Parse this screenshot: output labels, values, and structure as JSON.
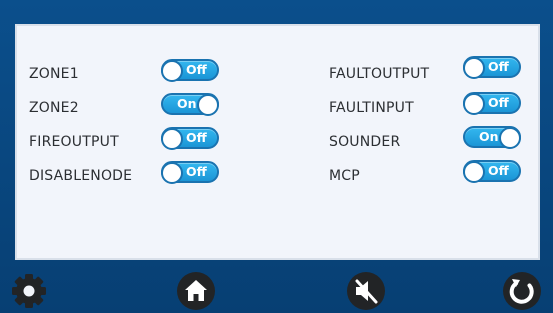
{
  "settings": {
    "left": [
      {
        "label": "ZONE1",
        "state": "Off"
      },
      {
        "label": "ZONE2",
        "state": "On"
      },
      {
        "label": "FIREOUTPUT",
        "state": "Off"
      },
      {
        "label": "DISABLENODE",
        "state": "Off"
      }
    ],
    "right": [
      {
        "label": "FAULTOUTPUT",
        "state": "Off"
      },
      {
        "label": "FAULTINPUT",
        "state": "Off"
      },
      {
        "label": "SOUNDER",
        "state": "On"
      },
      {
        "label": "MCP",
        "state": "Off"
      }
    ]
  },
  "nav": {
    "icons": [
      "gear-icon",
      "home-icon",
      "mute-icon",
      "refresh-icon"
    ]
  },
  "colors": {
    "frame": "#08467e",
    "panel": "#f2f5fb",
    "toggle": "#1b95d6",
    "icon": "#222426"
  }
}
